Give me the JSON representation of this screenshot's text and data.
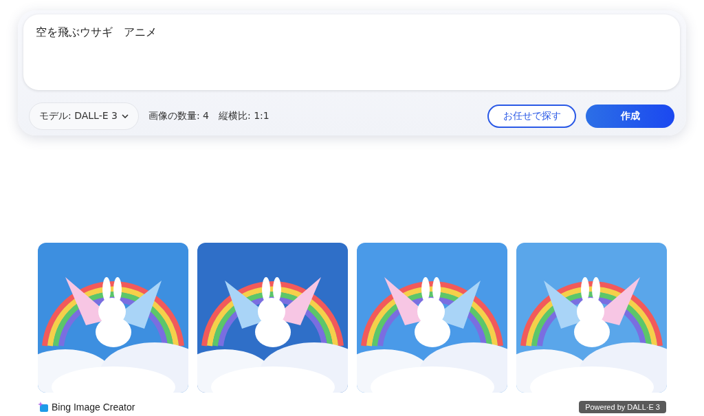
{
  "prompt": {
    "value": "空を飛ぶウサギ　アニメ"
  },
  "model_selector": {
    "label": "モデル: DALL-E 3"
  },
  "settings": [
    {
      "label": "画像の数量: 4"
    },
    {
      "label": "縦横比: 1:1"
    }
  ],
  "buttons": [
    {
      "kind": "outline",
      "label": "お任せで探す"
    },
    {
      "kind": "primary",
      "label": "作成"
    }
  ],
  "footer": {
    "brand": "Bing Image Creator",
    "badge": "Powered by DALL·E 3"
  }
}
